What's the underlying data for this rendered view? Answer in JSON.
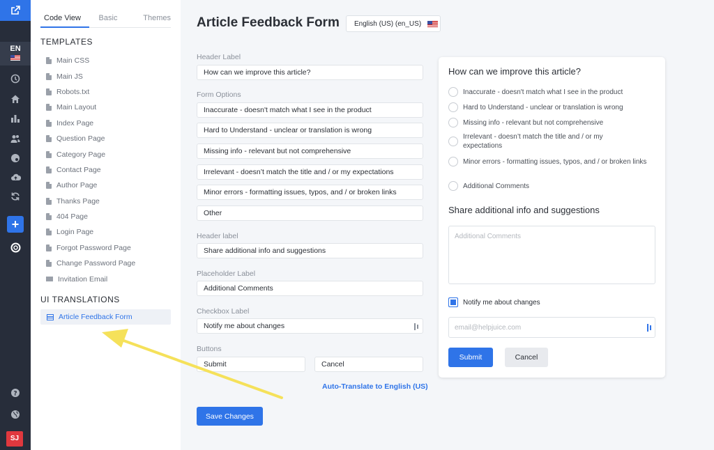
{
  "rail": {
    "lang_code": "EN",
    "avatar_initials": "SJ",
    "icons": [
      "external-link-icon",
      "history-icon",
      "home-icon",
      "bar-chart-icon",
      "users-icon",
      "palette-icon",
      "cloud-upload-icon",
      "refresh-icon",
      "plus-icon",
      "lifebuoy-icon",
      "help-icon",
      "globe-icon"
    ]
  },
  "panel": {
    "tabs": [
      "Code View",
      "Basic",
      "Themes"
    ],
    "templates_heading": "TEMPLATES",
    "templates": [
      "Main CSS",
      "Main JS",
      "Robots.txt",
      "Main Layout",
      "Index Page",
      "Question Page",
      "Category Page",
      "Contact Page",
      "Author Page",
      "Thanks Page",
      "404 Page",
      "Login Page",
      "Forgot Password Page",
      "Change Password Page",
      "Invitation Email"
    ],
    "translations_heading": "UI TRANSLATIONS",
    "translation_item": "Article Feedback Form"
  },
  "main": {
    "title": "Article Feedback Form",
    "language": "English (US) (en_US)",
    "header_label_caption": "Header Label",
    "header_label_value": "How can we improve this article?",
    "form_options_caption": "Form Options",
    "form_options": [
      "Inaccurate - doesn't match what I see in the product",
      "Hard to Understand - unclear or translation is wrong",
      "Missing info - relevant but not comprehensive",
      "Irrelevant - doesn’t match the title and / or my expectations",
      "Minor errors - formatting issues, typos, and / or broken links",
      "Other"
    ],
    "header_label2_caption": "Header label",
    "header_label2_value": "Share additional info and suggestions",
    "placeholder_caption": "Placeholder Label",
    "placeholder_value": "Additional Comments",
    "checkbox_caption": "Checkbox Label",
    "checkbox_value": "Notify me about changes",
    "buttons_caption": "Buttons",
    "button_submit_value": "Submit",
    "button_cancel_value": "Cancel",
    "auto_translate": "Auto-Translate to English (US)",
    "save": "Save Changes"
  },
  "preview": {
    "heading": "How can we improve this article?",
    "options": [
      "Inaccurate - doesn't match what I see in the product",
      "Hard to Understand - unclear or translation is wrong",
      "Missing info - relevant but not comprehensive",
      "Irrelevant - doesn’t match the title and / or my expectations",
      "Minor errors - formatting issues, typos, and / or broken links",
      "Additional Comments"
    ],
    "heading2": "Share additional info and suggestions",
    "textarea_placeholder": "Additional Comments",
    "checkbox_label": "Notify me about changes",
    "email_placeholder": "email@helpjuice.com",
    "submit": "Submit",
    "cancel": "Cancel"
  },
  "colors": {
    "accent": "#2f74e8",
    "rail": "#272d3a",
    "arrow": "#f5e15a"
  }
}
